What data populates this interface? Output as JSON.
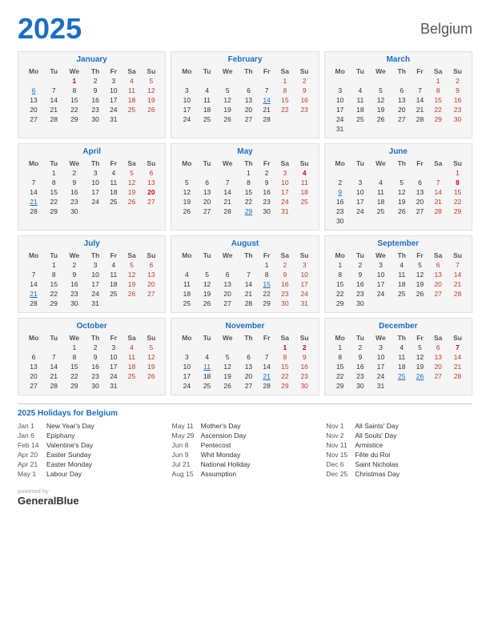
{
  "header": {
    "year": "2025",
    "country": "Belgium"
  },
  "months": [
    {
      "name": "January",
      "days": [
        [
          "",
          "",
          "1",
          "2",
          "3",
          "4",
          "5"
        ],
        [
          "6",
          "7",
          "8",
          "9",
          "10",
          "11",
          "12"
        ],
        [
          "13",
          "14",
          "15",
          "16",
          "17",
          "18",
          "19"
        ],
        [
          "20",
          "21",
          "22",
          "23",
          "24",
          "25",
          "26"
        ],
        [
          "27",
          "28",
          "29",
          "30",
          "31",
          "",
          ""
        ]
      ],
      "red_cells": {
        "0-2": true
      },
      "blue_underline": {
        "1-0": true
      }
    },
    {
      "name": "February",
      "days": [
        [
          "",
          "",
          "",
          "",
          "",
          "1",
          "2"
        ],
        [
          "3",
          "4",
          "5",
          "6",
          "7",
          "8",
          "9"
        ],
        [
          "10",
          "11",
          "12",
          "13",
          "14",
          "15",
          "16"
        ],
        [
          "17",
          "18",
          "19",
          "20",
          "21",
          "22",
          "23"
        ],
        [
          "24",
          "25",
          "26",
          "27",
          "28",
          "",
          ""
        ]
      ],
      "red_cells": {},
      "blue_underline": {
        "2-4": true
      }
    },
    {
      "name": "March",
      "days": [
        [
          "",
          "",
          "",
          "",
          "",
          "1",
          "2"
        ],
        [
          "3",
          "4",
          "5",
          "6",
          "7",
          "8",
          "9"
        ],
        [
          "10",
          "11",
          "12",
          "13",
          "14",
          "15",
          "16"
        ],
        [
          "17",
          "18",
          "19",
          "20",
          "21",
          "22",
          "23"
        ],
        [
          "24",
          "25",
          "26",
          "27",
          "28",
          "29",
          "30"
        ],
        [
          "31",
          "",
          "",
          "",
          "",
          "",
          ""
        ]
      ],
      "red_cells": {},
      "blue_underline": {}
    },
    {
      "name": "April",
      "days": [
        [
          "",
          "1",
          "2",
          "3",
          "4",
          "5",
          "6"
        ],
        [
          "7",
          "8",
          "9",
          "10",
          "11",
          "12",
          "13"
        ],
        [
          "14",
          "15",
          "16",
          "17",
          "18",
          "19",
          "20"
        ],
        [
          "21",
          "22",
          "23",
          "24",
          "25",
          "26",
          "27"
        ],
        [
          "28",
          "29",
          "30",
          "",
          "",
          "",
          ""
        ]
      ],
      "red_cells": {
        "2-6": true
      },
      "blue_underline": {
        "3-0": true
      }
    },
    {
      "name": "May",
      "days": [
        [
          "",
          "",
          "",
          "1",
          "2",
          "3",
          "4"
        ],
        [
          "5",
          "6",
          "7",
          "8",
          "9",
          "10",
          "11"
        ],
        [
          "12",
          "13",
          "14",
          "15",
          "16",
          "17",
          "18"
        ],
        [
          "19",
          "20",
          "21",
          "22",
          "23",
          "24",
          "25"
        ],
        [
          "26",
          "27",
          "28",
          "29",
          "30",
          "31",
          ""
        ]
      ],
      "red_cells": {
        "0-6": true
      },
      "blue_underline": {
        "4-3": true
      }
    },
    {
      "name": "June",
      "days": [
        [
          "",
          "",
          "",
          "",
          "",
          "",
          "1"
        ],
        [
          "2",
          "3",
          "4",
          "5",
          "6",
          "7",
          "8"
        ],
        [
          "9",
          "10",
          "11",
          "12",
          "13",
          "14",
          "15"
        ],
        [
          "16",
          "17",
          "18",
          "19",
          "20",
          "21",
          "22"
        ],
        [
          "23",
          "24",
          "25",
          "26",
          "27",
          "28",
          "29"
        ],
        [
          "30",
          "",
          "",
          "",
          "",
          "",
          ""
        ]
      ],
      "red_cells": {
        "1-6": true
      },
      "blue_underline": {
        "2-0": true
      }
    },
    {
      "name": "July",
      "days": [
        [
          "",
          "1",
          "2",
          "3",
          "4",
          "5",
          "6"
        ],
        [
          "7",
          "8",
          "9",
          "10",
          "11",
          "12",
          "13"
        ],
        [
          "14",
          "15",
          "16",
          "17",
          "18",
          "19",
          "20"
        ],
        [
          "21",
          "22",
          "23",
          "24",
          "25",
          "26",
          "27"
        ],
        [
          "28",
          "29",
          "30",
          "31",
          "",
          "",
          ""
        ]
      ],
      "red_cells": {},
      "blue_underline": {
        "3-0": true
      }
    },
    {
      "name": "August",
      "days": [
        [
          "",
          "",
          "",
          "",
          "1",
          "2",
          "3"
        ],
        [
          "4",
          "5",
          "6",
          "7",
          "8",
          "9",
          "10"
        ],
        [
          "11",
          "12",
          "13",
          "14",
          "15",
          "16",
          "17"
        ],
        [
          "18",
          "19",
          "20",
          "21",
          "22",
          "23",
          "24"
        ],
        [
          "25",
          "26",
          "27",
          "28",
          "29",
          "30",
          "31"
        ]
      ],
      "red_cells": {},
      "blue_underline": {
        "2-4": true
      }
    },
    {
      "name": "September",
      "days": [
        [
          "1",
          "2",
          "3",
          "4",
          "5",
          "6",
          "7"
        ],
        [
          "8",
          "9",
          "10",
          "11",
          "12",
          "13",
          "14"
        ],
        [
          "15",
          "16",
          "17",
          "18",
          "19",
          "20",
          "21"
        ],
        [
          "22",
          "23",
          "24",
          "25",
          "26",
          "27",
          "28"
        ],
        [
          "29",
          "30",
          "",
          "",
          "",
          "",
          ""
        ]
      ],
      "red_cells": {},
      "blue_underline": {}
    },
    {
      "name": "October",
      "days": [
        [
          "",
          "",
          "1",
          "2",
          "3",
          "4",
          "5"
        ],
        [
          "6",
          "7",
          "8",
          "9",
          "10",
          "11",
          "12"
        ],
        [
          "13",
          "14",
          "15",
          "16",
          "17",
          "18",
          "19"
        ],
        [
          "20",
          "21",
          "22",
          "23",
          "24",
          "25",
          "26"
        ],
        [
          "27",
          "28",
          "29",
          "30",
          "31",
          "",
          ""
        ]
      ],
      "red_cells": {},
      "blue_underline": {}
    },
    {
      "name": "November",
      "days": [
        [
          "",
          "",
          "",
          "",
          "",
          "1",
          "2"
        ],
        [
          "3",
          "4",
          "5",
          "6",
          "7",
          "8",
          "9"
        ],
        [
          "10",
          "11",
          "12",
          "13",
          "14",
          "15",
          "16"
        ],
        [
          "17",
          "18",
          "19",
          "20",
          "21",
          "22",
          "23"
        ],
        [
          "24",
          "25",
          "26",
          "27",
          "28",
          "29",
          "30"
        ]
      ],
      "red_cells": {
        "0-5": true,
        "0-6": true
      },
      "blue_underline": {
        "2-1": true,
        "3-4": true
      }
    },
    {
      "name": "December",
      "days": [
        [
          "1",
          "2",
          "3",
          "4",
          "5",
          "6",
          "7"
        ],
        [
          "8",
          "9",
          "10",
          "11",
          "12",
          "13",
          "14"
        ],
        [
          "15",
          "16",
          "17",
          "18",
          "19",
          "20",
          "21"
        ],
        [
          "22",
          "23",
          "24",
          "25",
          "26",
          "27",
          "28"
        ],
        [
          "29",
          "30",
          "31",
          "",
          "",
          "",
          ""
        ]
      ],
      "red_cells": {
        "0-6": true
      },
      "blue_underline": {
        "3-3": true,
        "3-4": true
      }
    }
  ],
  "weekdays": [
    "Mo",
    "Tu",
    "We",
    "Th",
    "Fr",
    "Sa",
    "Su"
  ],
  "holidays_title": "2025 Holidays for Belgium",
  "holidays": {
    "col1": [
      {
        "date": "Jan 1",
        "name": "New Year's Day"
      },
      {
        "date": "Jan 6",
        "name": "Epiphany"
      },
      {
        "date": "Feb 14",
        "name": "Valentine's Day"
      },
      {
        "date": "Apr 20",
        "name": "Easter Sunday"
      },
      {
        "date": "Apr 21",
        "name": "Easter Monday"
      },
      {
        "date": "May 1",
        "name": "Labour Day"
      }
    ],
    "col2": [
      {
        "date": "May 11",
        "name": "Mother's Day"
      },
      {
        "date": "May 29",
        "name": "Ascension Day"
      },
      {
        "date": "Jun 8",
        "name": "Pentecost"
      },
      {
        "date": "Jun 9",
        "name": "Whit Monday"
      },
      {
        "date": "Jul 21",
        "name": "National Holiday"
      },
      {
        "date": "Aug 15",
        "name": "Assumption"
      }
    ],
    "col3": [
      {
        "date": "Nov 1",
        "name": "All Saints' Day"
      },
      {
        "date": "Nov 2",
        "name": "All Souls' Day"
      },
      {
        "date": "Nov 11",
        "name": "Armistice"
      },
      {
        "date": "Nov 15",
        "name": "Fête du Roi"
      },
      {
        "date": "Dec 6",
        "name": "Saint Nicholas"
      },
      {
        "date": "Dec 25",
        "name": "Christmas Day"
      }
    ]
  },
  "footer": {
    "powered_by": "powered by",
    "brand_first": "General",
    "brand_second": "Blue"
  }
}
